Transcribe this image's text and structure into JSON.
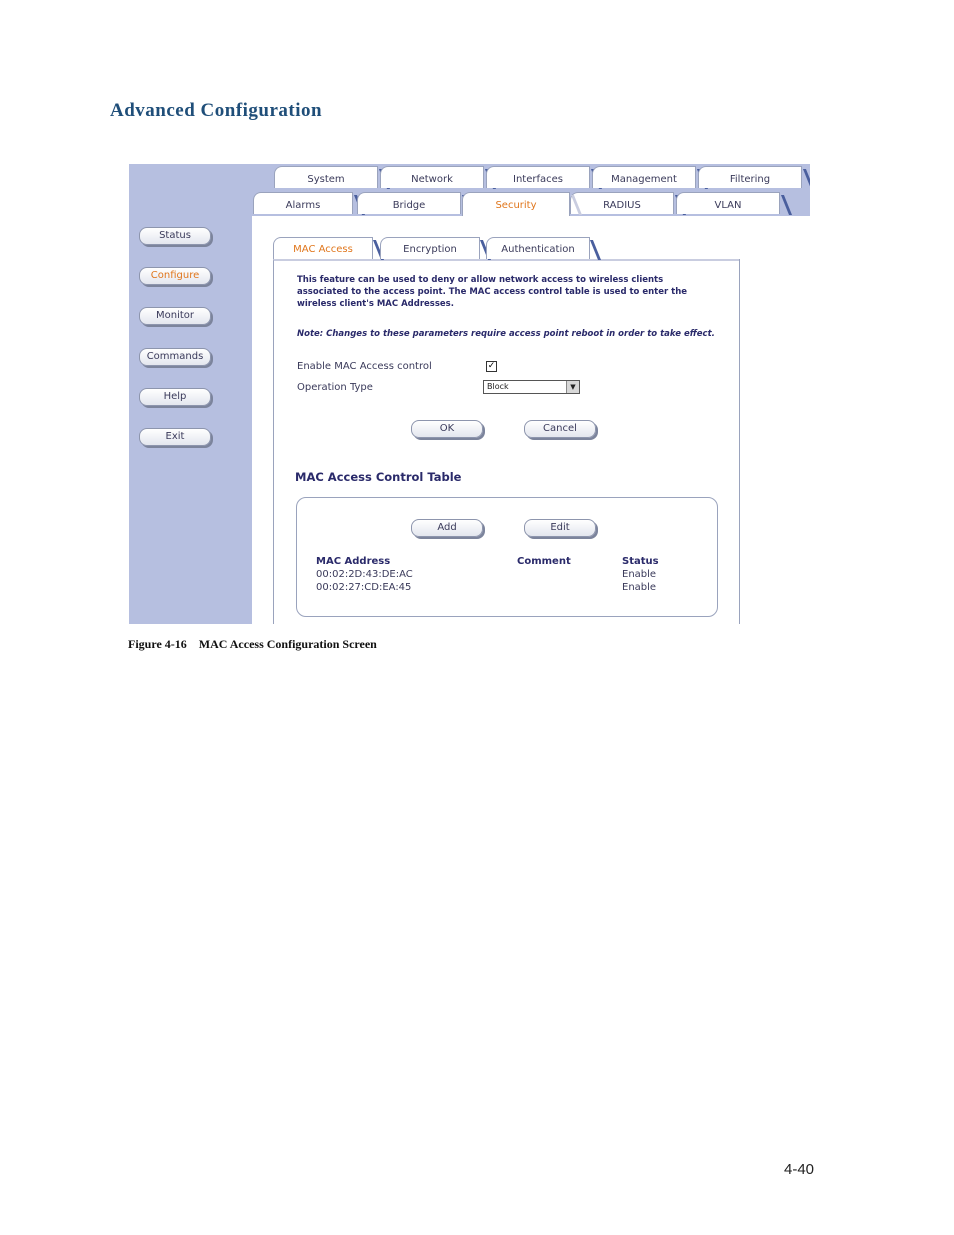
{
  "heading": "Advanced Configuration",
  "top_tabs_row1": [
    "System",
    "Network",
    "Interfaces",
    "Management",
    "Filtering"
  ],
  "top_tabs_row2": [
    "Alarms",
    "Bridge",
    "Security",
    "RADIUS",
    "VLAN"
  ],
  "sidebar": [
    "Status",
    "Configure",
    "Monitor",
    "Commands",
    "Help",
    "Exit"
  ],
  "sub_tabs": [
    "MAC Access",
    "Encryption",
    "Authentication"
  ],
  "description": "This feature can be used to deny or allow network access to wireless clients associated to the access point. The MAC access control table is used to enter the wireless client's MAC Addresses.",
  "note": "Note: Changes to these parameters require access point reboot in order to take effect.",
  "form": {
    "enable_label": "Enable MAC Access control",
    "enable_checked": true,
    "operation_label": "Operation Type",
    "operation_value": "Block"
  },
  "buttons": {
    "ok": "OK",
    "cancel": "Cancel",
    "add": "Add",
    "edit": "Edit"
  },
  "table": {
    "title": "MAC Access Control Table",
    "columns": [
      "MAC Address",
      "Comment",
      "Status"
    ],
    "rows": [
      {
        "mac": "00:02:2D:43:DE:AC",
        "comment": "",
        "status": "Enable"
      },
      {
        "mac": "00:02:27:CD:EA:45",
        "comment": "",
        "status": "Enable"
      }
    ]
  },
  "caption": "Figure 4-16    MAC Access Configuration Screen",
  "page_number": "4-40",
  "colors": {
    "heading": "#1f4e79",
    "active": "#e0761c",
    "sidebar_bg": "#b6bfe0"
  }
}
